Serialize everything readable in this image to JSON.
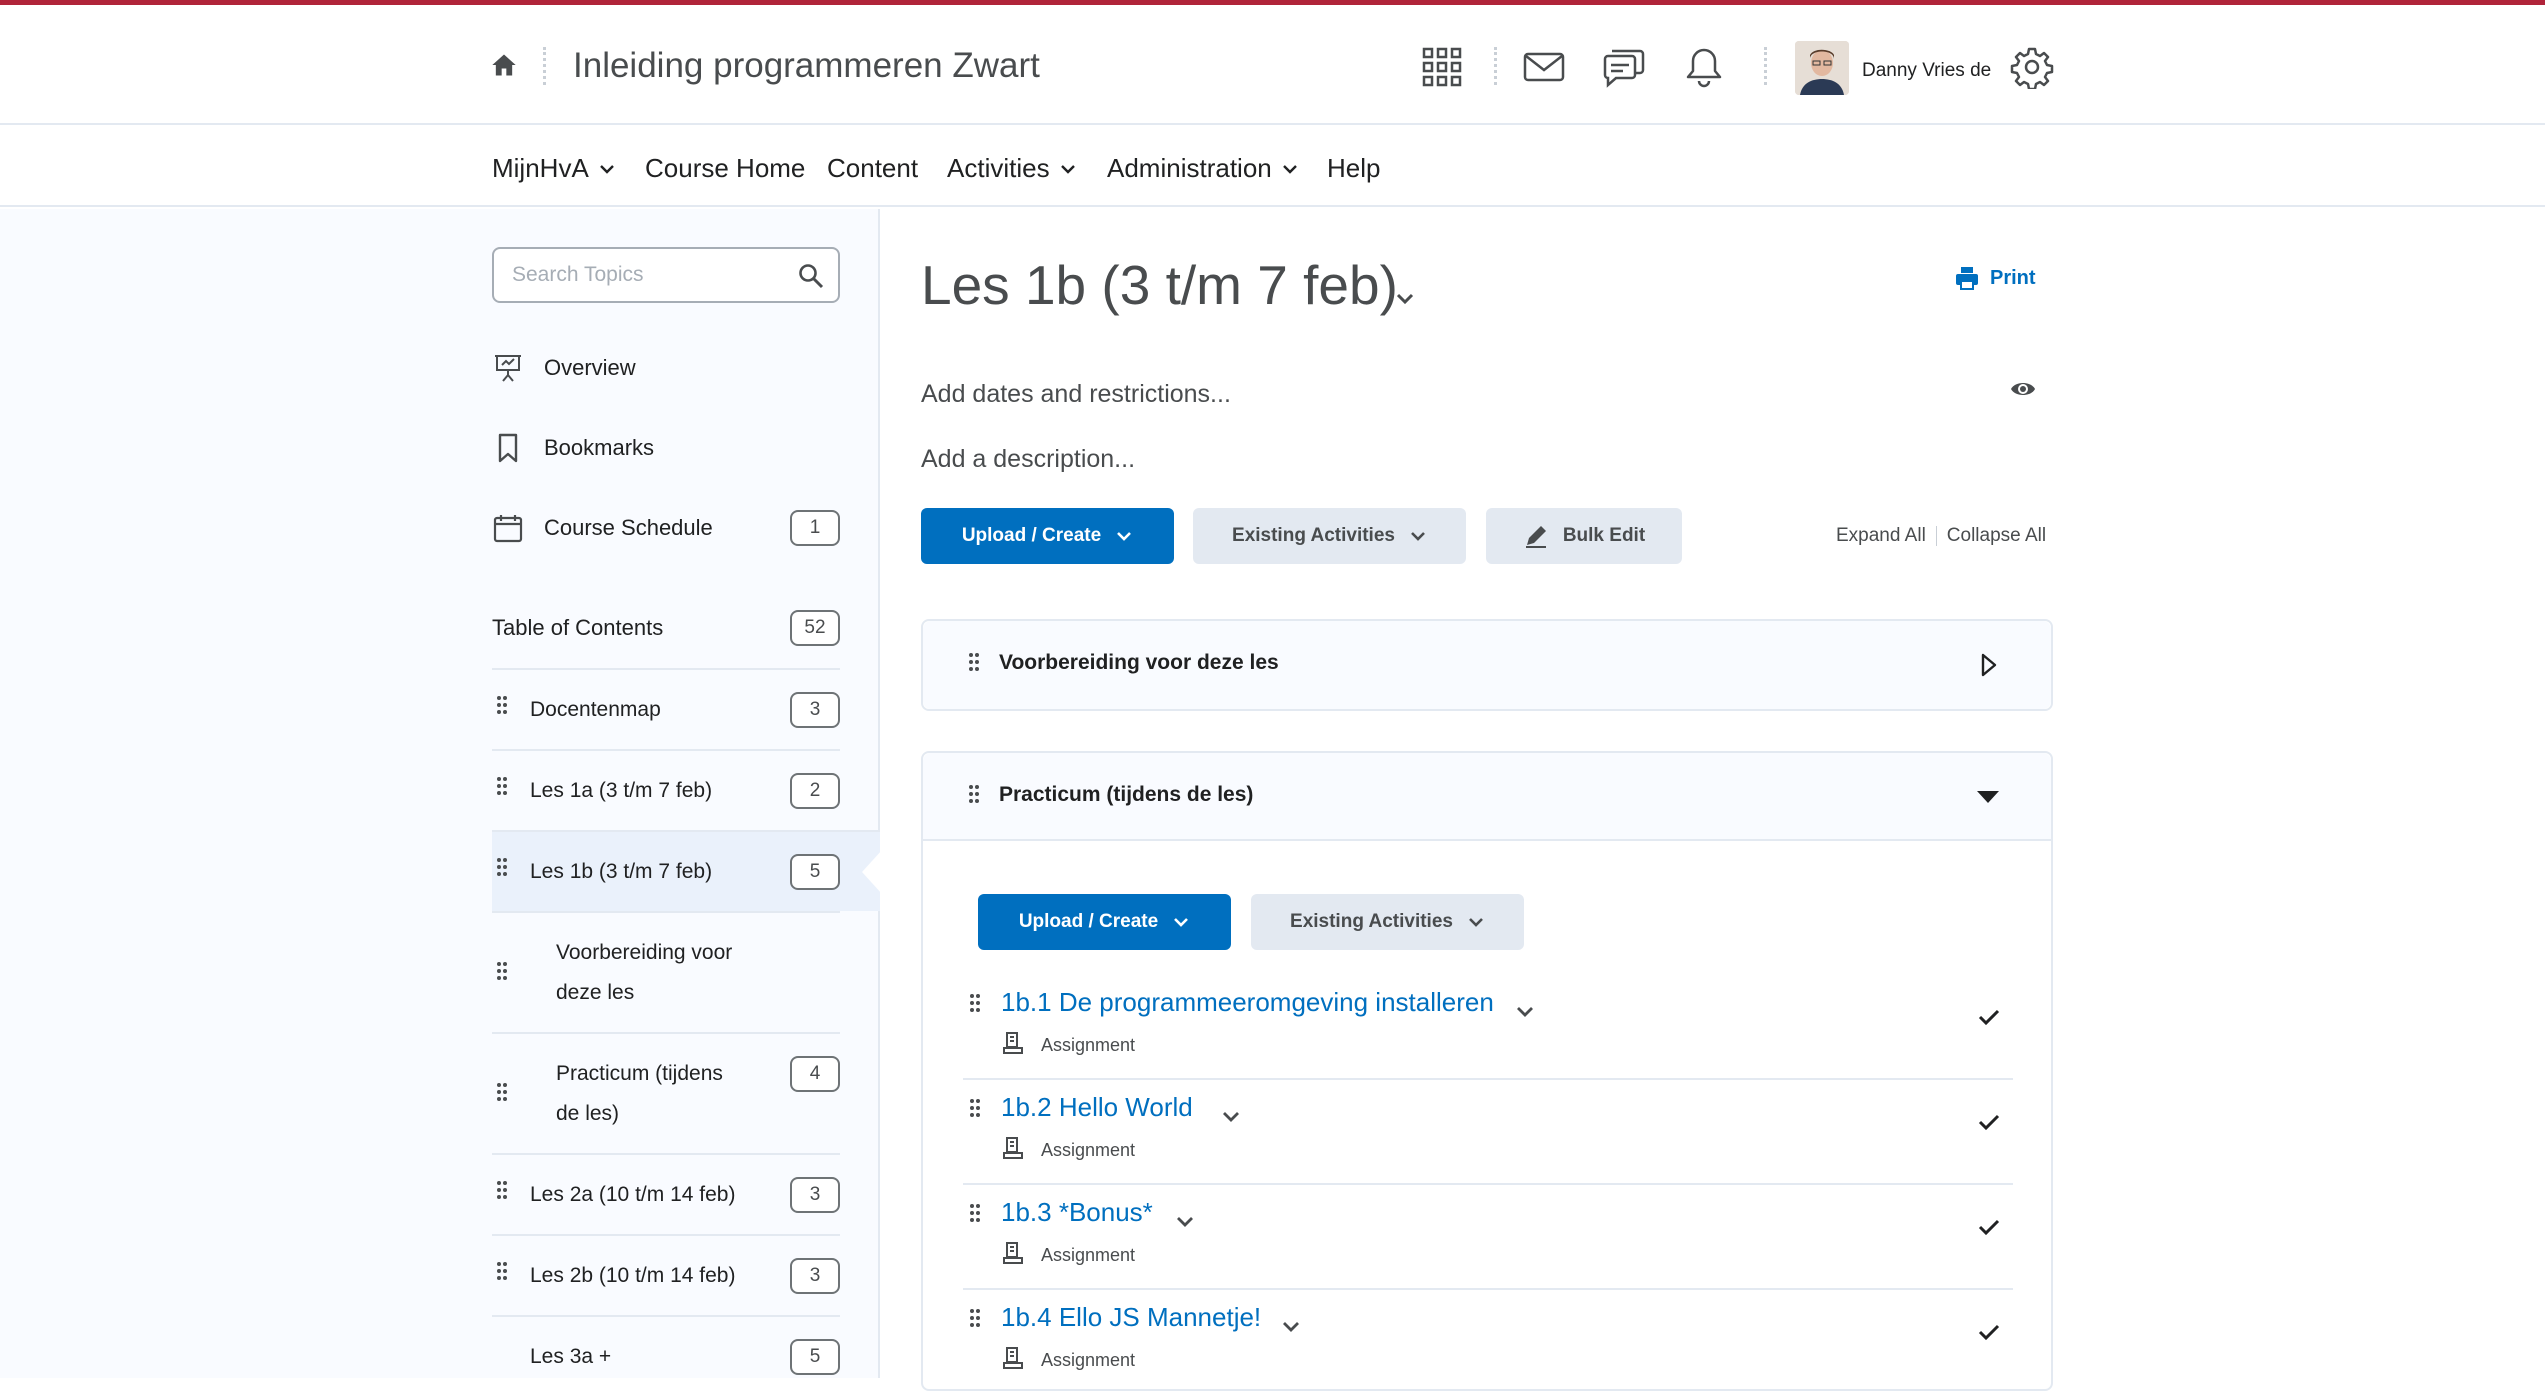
{
  "colors": {
    "accent": "#b0243a",
    "primary": "#006fbf",
    "text": "#202122",
    "muted": "#494c4e",
    "border": "#e3e9f1"
  },
  "header": {
    "course_title": "Inleiding programmeren Zwart",
    "user_name": "Danny Vries de"
  },
  "nav": {
    "items": [
      {
        "label": "MijnHvA",
        "dropdown": true
      },
      {
        "label": "Course Home",
        "dropdown": false
      },
      {
        "label": "Content",
        "dropdown": false
      },
      {
        "label": "Activities",
        "dropdown": true
      },
      {
        "label": "Administration",
        "dropdown": true
      },
      {
        "label": "Help",
        "dropdown": false
      }
    ]
  },
  "sidebar": {
    "search_placeholder": "Search Topics",
    "links": [
      {
        "label": "Overview",
        "icon": "presentation-icon"
      },
      {
        "label": "Bookmarks",
        "icon": "bookmark-icon"
      },
      {
        "label": "Course Schedule",
        "icon": "calendar-icon",
        "count": "1"
      }
    ],
    "toc_label": "Table of Contents",
    "toc_count": "52",
    "toc": [
      {
        "label": "Docentenmap",
        "count": "3"
      },
      {
        "label": "Les 1a (3 t/m 7 feb)",
        "count": "2"
      },
      {
        "label": "Les 1b (3 t/m 7 feb)",
        "count": "5",
        "active": true
      },
      {
        "label_line1": "Voorbereiding voor",
        "label_line2": "deze les",
        "sub": true
      },
      {
        "label_line1": "Practicum (tijdens",
        "label_line2": "de les)",
        "count": "4",
        "sub": true
      },
      {
        "label": "Les 2a (10 t/m 14 feb)",
        "count": "3"
      },
      {
        "label": "Les 2b (10 t/m 14 feb)",
        "count": "3"
      },
      {
        "label": "Les 3a +",
        "count": "5"
      }
    ]
  },
  "main": {
    "title": "Les 1b (3 t/m 7 feb)",
    "print_label": "Print",
    "add_dates": "Add dates and restrictions...",
    "add_description": "Add a description...",
    "upload_create": "Upload / Create",
    "existing_activities": "Existing Activities",
    "bulk_edit": "Bulk Edit",
    "expand_all": "Expand All",
    "collapse_all": "Collapse All",
    "modules": [
      {
        "title": "Voorbereiding voor deze les",
        "expanded": false
      },
      {
        "title": "Practicum (tijdens de les)",
        "expanded": true,
        "upload_create": "Upload / Create",
        "existing_activities": "Existing Activities",
        "topics": [
          {
            "title": "1b.1 De programmeeromgeving installeren",
            "type": "Assignment",
            "done": true
          },
          {
            "title": "1b.2 Hello World",
            "type": "Assignment",
            "done": true
          },
          {
            "title": "1b.3 *Bonus*",
            "type": "Assignment",
            "done": true
          },
          {
            "title": "1b.4 Ello JS Mannetje!",
            "type": "Assignment",
            "done": true
          }
        ]
      }
    ]
  }
}
